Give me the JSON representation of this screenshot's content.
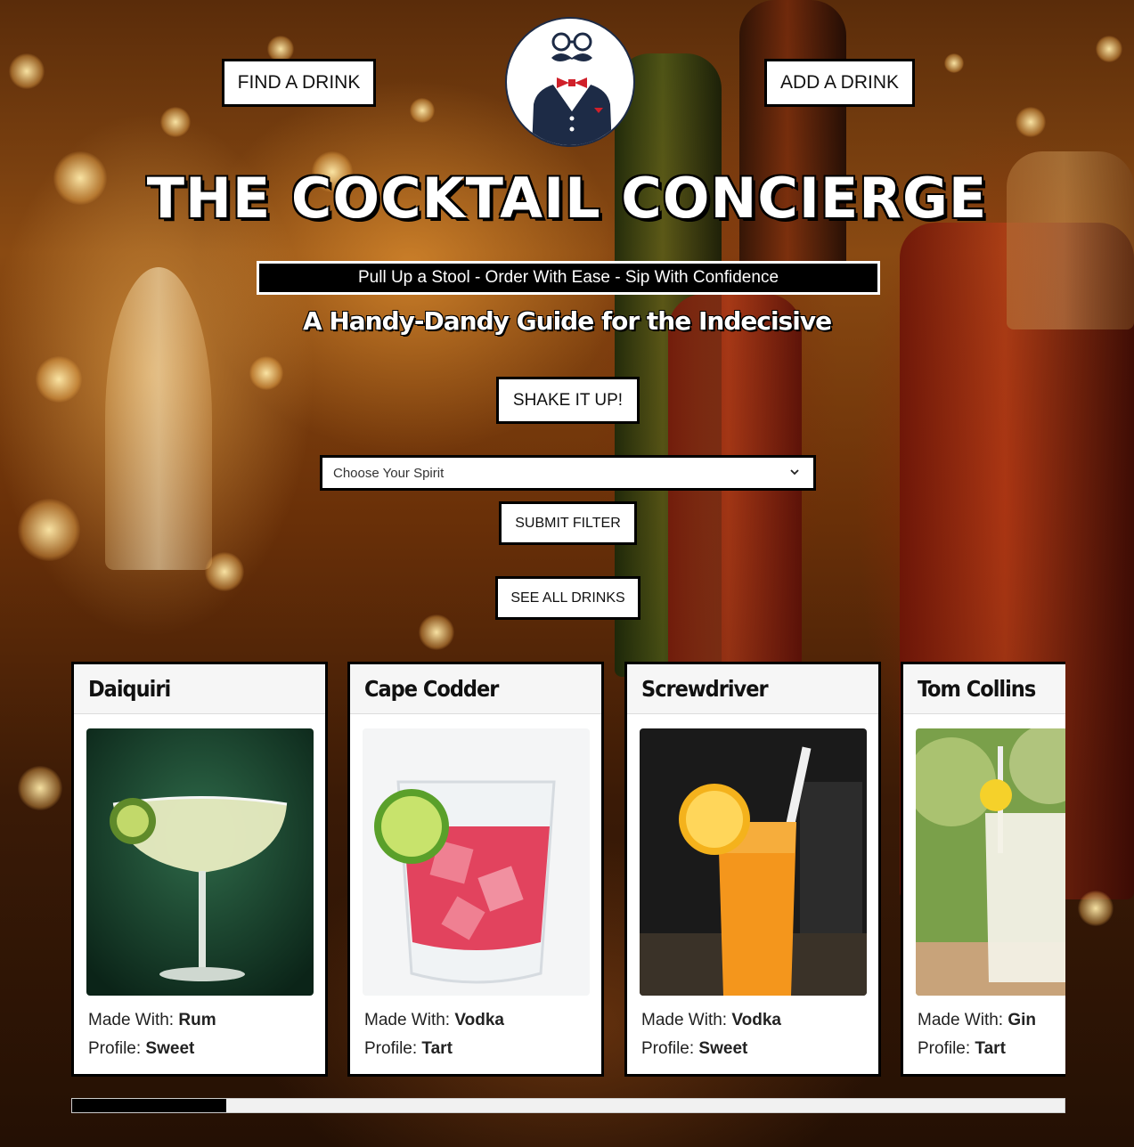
{
  "header": {
    "find_label": "FIND A DRINK",
    "add_label": "ADD A DRINK",
    "title": "THE COCKTAIL CONCIERGE",
    "tagline": "Pull Up a Stool - Order With Ease - Sip With Confidence",
    "subtitle": "A Handy-Dandy Guide for the Indecisive"
  },
  "controls": {
    "shake_label": "SHAKE IT UP!",
    "spirit_select": "Choose Your Spirit",
    "submit_label": "SUBMIT FILTER",
    "see_all_label": "SEE ALL DRINKS"
  },
  "cards": [
    {
      "name": "Daiquiri",
      "made_with_label": "Made With: ",
      "spirit": "Rum",
      "profile_label": "Profile: ",
      "profile": "Sweet"
    },
    {
      "name": "Cape Codder",
      "made_with_label": "Made With: ",
      "spirit": "Vodka",
      "profile_label": "Profile: ",
      "profile": "Tart"
    },
    {
      "name": "Screwdriver",
      "made_with_label": "Made With: ",
      "spirit": "Vodka",
      "profile_label": "Profile: ",
      "profile": "Sweet"
    },
    {
      "name": "Tom Collins",
      "made_with_label": "Made With: ",
      "spirit": "Gin",
      "profile_label": "Profile: ",
      "profile": "Tart"
    }
  ],
  "scroll_position": 0.155,
  "colors": {
    "accent": "#000000",
    "logo_navy": "#1d2b46",
    "bowtie": "#d0202a"
  }
}
